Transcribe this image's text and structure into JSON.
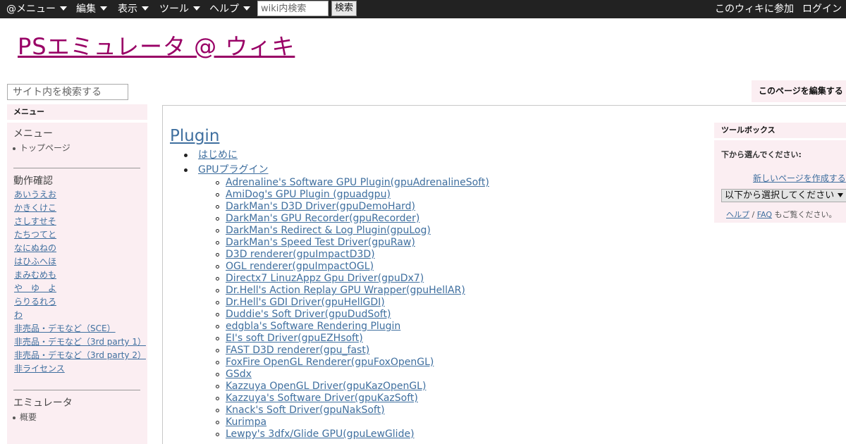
{
  "topbar": {
    "menus": [
      "@メニュー",
      "編集",
      "表示",
      "ツール",
      "ヘルプ"
    ],
    "search_placeholder": "wiki内検索",
    "search_button": "検索",
    "join": "このウィキに参加",
    "login": "ログイン"
  },
  "site": {
    "title": "PSエミュレータ @ ウィキ",
    "search_placeholder": "サイト内を検索する",
    "edit_button": "このページを編集する"
  },
  "menu": {
    "heading": "メニュー",
    "section1_title": "メニュー",
    "section1_items": [
      "トップページ"
    ],
    "section2_title": "動作確認",
    "section2_links": [
      "あいうえお",
      "かきくけこ",
      "さしすせそ",
      "たちつてと",
      "なにぬねの",
      "はひふへほ",
      "まみむめも",
      "や　ゆ　よ",
      "らりるれろ",
      "わ",
      "非売品・デモなど（SCE）",
      "非売品・デモなど（3rd party 1）",
      "非売品・デモなど（3rd party 2）",
      "非ライセンス"
    ],
    "section3_title": "エミュレータ",
    "section3_items": [
      "概要"
    ]
  },
  "content": {
    "heading": "Plugin",
    "top_items": [
      "はじめに",
      "GPUプラグイン"
    ],
    "gpu_plugins": [
      "Adrenaline's Software GPU Plugin(gpuAdrenalineSoft)",
      "AmiDog's GPU Plugin (gpuadgpu)",
      "DarkMan's D3D Driver(gpuDemoHard)",
      "DarkMan's GPU Recorder(gpuRecorder)",
      "DarkMan's Redirect & Log Plugin(gpuLog)",
      "DarkMan's Speed Test Driver(gpuRaw)",
      "D3D renderer(gpuImpactD3D)",
      "OGL renderer(gpuImpactOGL)",
      "Directx7 LinuzAppz Gpu Driver(gpuDx7)",
      "Dr.Hell's Action Replay GPU Wrapper(gpuHellAR)",
      "Dr.Hell's GDI Driver(gpuHellGDI)",
      "Duddie's Soft Driver(gpuDudSoft)",
      "edgbla's Software Rendering Plugin",
      "EI's soft Driver(gpuEZHsoft)",
      "FAST D3D renderer(gpu_fast)",
      "FoxFire OpenGL Renderer(gpuFoxOpenGL)",
      "GSdx",
      "Kazzuya OpenGL Driver(gpuKazOpenGL)",
      "Kazzuya's Software Driver(gpuKazSoft)",
      "Knack's Soft Driver(gpuNakSoft)",
      "Kurimpa",
      "Lewpy's 3dfx/Glide GPU(gpuLewGlide)"
    ]
  },
  "toolbox": {
    "heading": "ツールボックス",
    "prompt": "下から選んでください:",
    "new_page": "新しいページを作成する",
    "select_value": "以下から選択してください",
    "help": "ヘルプ",
    "faq": "FAQ",
    "help_suffix": "もご覧ください。"
  }
}
